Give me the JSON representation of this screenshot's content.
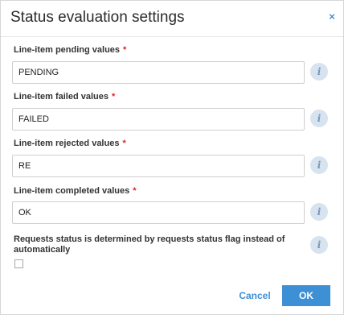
{
  "dialog": {
    "title": "Status evaluation settings",
    "close_glyph": "×",
    "close_icon": "close-icon",
    "info_icon": "info-icon",
    "info_glyph": "i",
    "accent_color": "#3d8fd6",
    "required_marker": "*",
    "required_color": "#e02020"
  },
  "fields": [
    {
      "label": "Line-item pending values",
      "value": "PENDING",
      "required": true
    },
    {
      "label": "Line-item failed values",
      "value": "FAILED",
      "required": true
    },
    {
      "label": "Line-item rejected values",
      "value": "RE",
      "required": true
    },
    {
      "label": "Line-item completed values",
      "value": "OK",
      "required": true
    }
  ],
  "requests_status_flag": {
    "label": "Requests status is determined by requests status flag instead of automatically",
    "checked": false
  },
  "footer": {
    "cancel_label": "Cancel",
    "ok_label": "OK"
  }
}
